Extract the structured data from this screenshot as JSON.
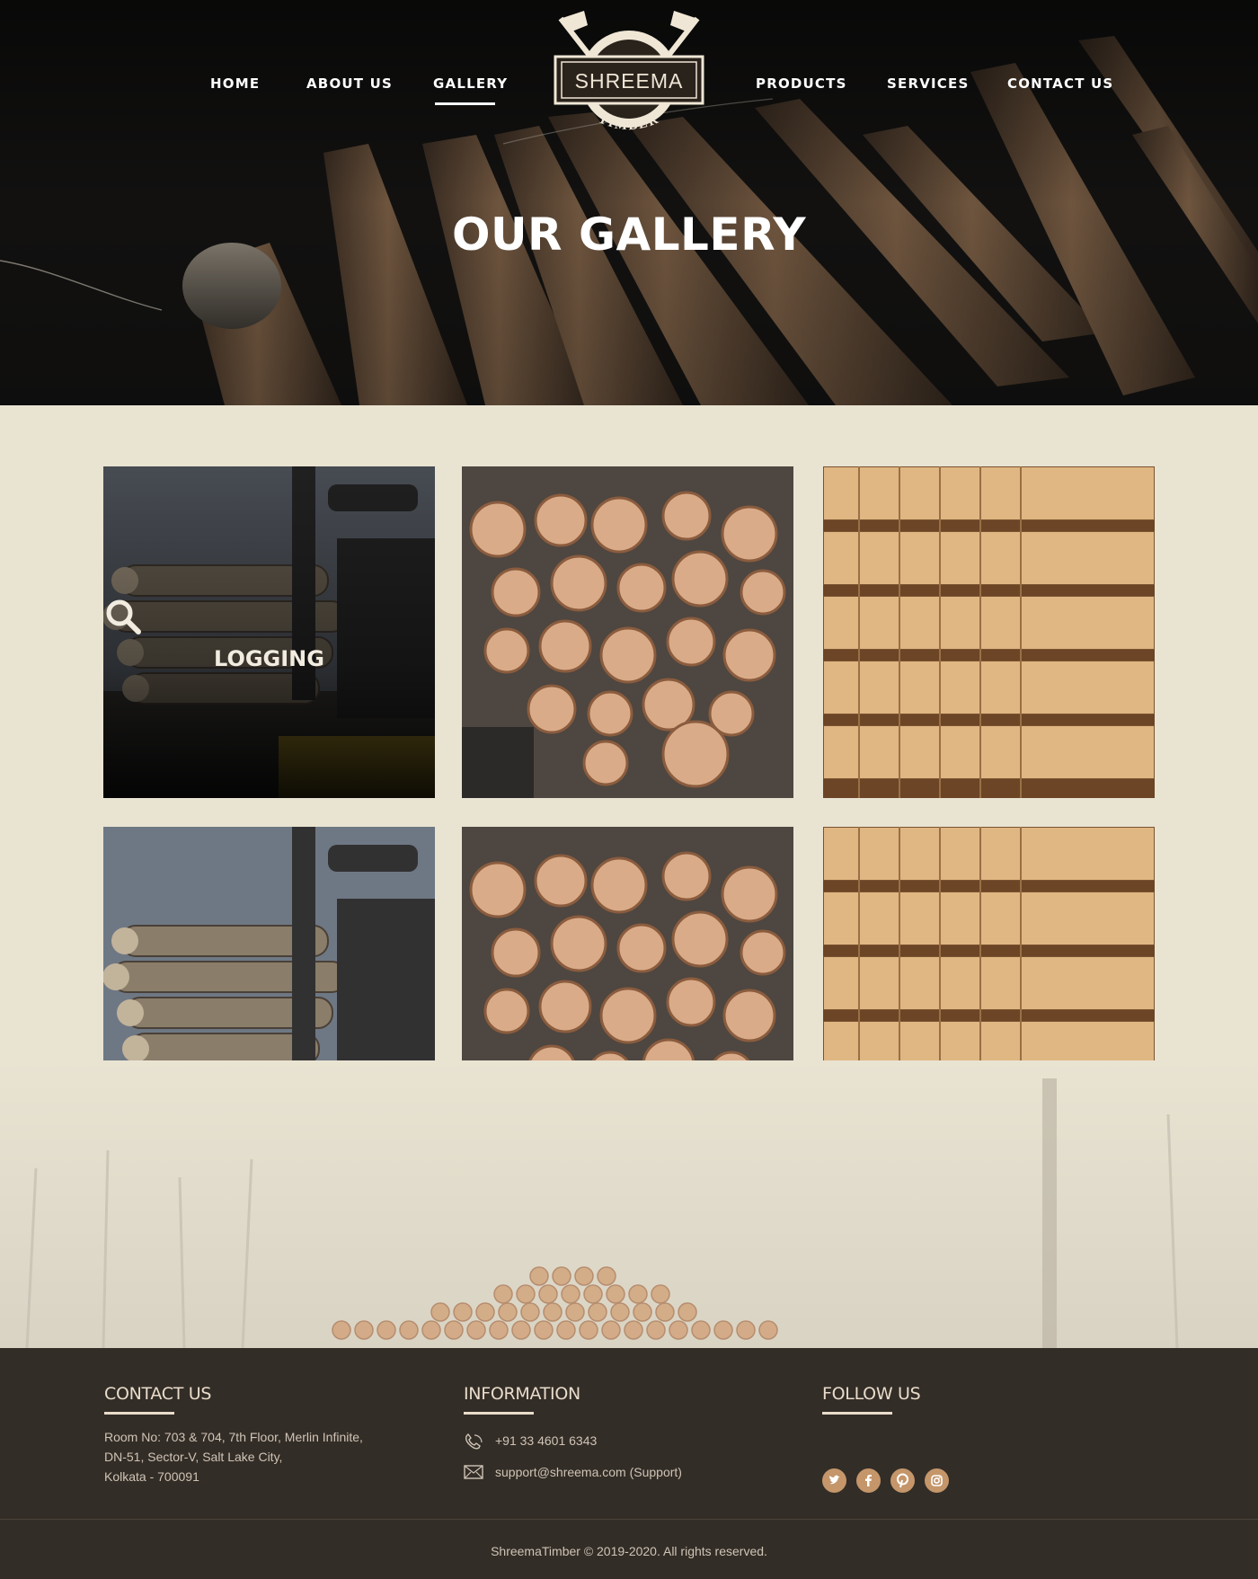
{
  "nav": {
    "home": "HOME",
    "about": "ABOUT US",
    "gallery": "GALLERY",
    "products": "PRODUCTS",
    "services": "SERVICES",
    "contact": "CONTACT US"
  },
  "logo": {
    "name": "SHREEMA",
    "tagline": "TIMBER"
  },
  "hero": {
    "title": "OUR GALLERY"
  },
  "gallery": {
    "hover_label": "LOGGING",
    "tiles": [
      "logging-truck",
      "log-pile",
      "lumber-stack",
      "logging-truck",
      "log-pile",
      "lumber-stack"
    ]
  },
  "footer": {
    "contact": {
      "heading": "CONTACT US",
      "address_line1": "Room No: 703 & 704, 7th Floor, Merlin Infinite,",
      "address_line2": "DN-51, Sector-V, Salt Lake City,",
      "address_line3": "Kolkata - 700091"
    },
    "information": {
      "heading": "INFORMATION",
      "phone": "+91 33 4601 6343",
      "email": "support@shreema.com (Support)"
    },
    "follow": {
      "heading": "FOLLOW US",
      "icons": [
        "twitter-icon",
        "facebook-icon",
        "pinterest-icon",
        "instagram-icon"
      ]
    },
    "copyright": "ShreemaTimber © 2019-2020. All rights reserved."
  },
  "colors": {
    "page_bg": "#e9e3d2",
    "footer_bg": "#332d27",
    "accent": "#c4966a",
    "heading_text": "#e9dccb"
  }
}
